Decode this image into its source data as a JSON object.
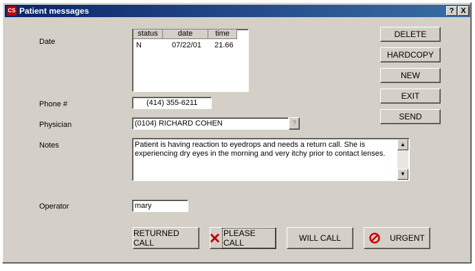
{
  "window": {
    "title": "Patient  messages",
    "app_icon": "CS",
    "help_button": "?",
    "close_button": "X"
  },
  "labels": {
    "date": "Date",
    "phone": "Phone #",
    "physician": "Physician",
    "notes": "Notes",
    "operator": "Operator"
  },
  "messages_table": {
    "columns": [
      "status",
      "date",
      "time"
    ],
    "rows": [
      {
        "status": "N",
        "date": "07/22/01",
        "time": "21.66"
      }
    ]
  },
  "fields": {
    "phone": "(414) 355-6211",
    "physician": "(0104) RICHARD COHEN",
    "physician_lookup": "?",
    "notes": "Patient is having reaction to eyedrops and needs a return call.  She is experiencing dry eyes in the morning and very itchy prior to contact lenses.",
    "operator": "mary"
  },
  "actions": {
    "delete": "DELETE",
    "hardcopy": "HARDCOPY",
    "new": "NEW",
    "exit": "EXIT",
    "send": "SEND"
  },
  "call_buttons": {
    "returned": "RETURNED CALL",
    "please": "PLEASE CALL",
    "will": "WILL CALL",
    "urgent": "URGENT"
  },
  "icons": {
    "please_call": "x-mark-icon",
    "urgent": "no-entry-icon",
    "urgent_color": "#d00000"
  }
}
